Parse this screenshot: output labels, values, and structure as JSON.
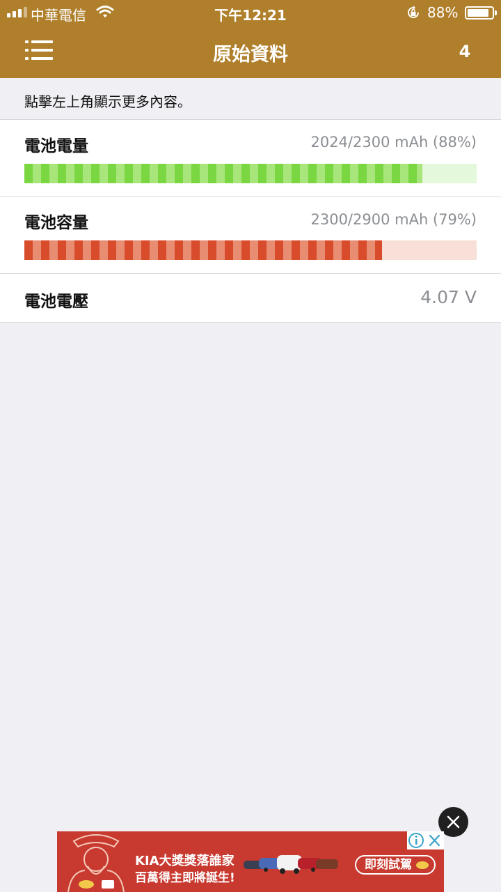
{
  "status_bar": {
    "carrier": "中華電信",
    "time": "下午12:21",
    "battery_percent": "88%",
    "battery_level": 0.88
  },
  "nav": {
    "title": "原始資料",
    "right_button": "4"
  },
  "hint": "點擊左上角顯示更多內容。",
  "rows": [
    {
      "label": "電池電量",
      "value": "2024/2300 mAh (88%)",
      "progress": 0.88,
      "color": "#7ad742"
    },
    {
      "label": "電池容量",
      "value": "2300/2900 mAh (79%)",
      "progress": 0.79,
      "color": "#d84c2c"
    },
    {
      "label": "電池電壓",
      "value": "4.07 V"
    }
  ],
  "ad": {
    "line1": "KIA大獎獎落誰家",
    "line2": "百萬得主即將誕生!",
    "cta": "即刻試駕",
    "background": "#c83a30"
  },
  "icons": {
    "menu": "menu-icon",
    "wifi": "wifi-icon",
    "orientation_lock": "orientation-lock-icon",
    "close": "close-icon",
    "info": "info-icon"
  },
  "accent_color": "#b07f2c"
}
